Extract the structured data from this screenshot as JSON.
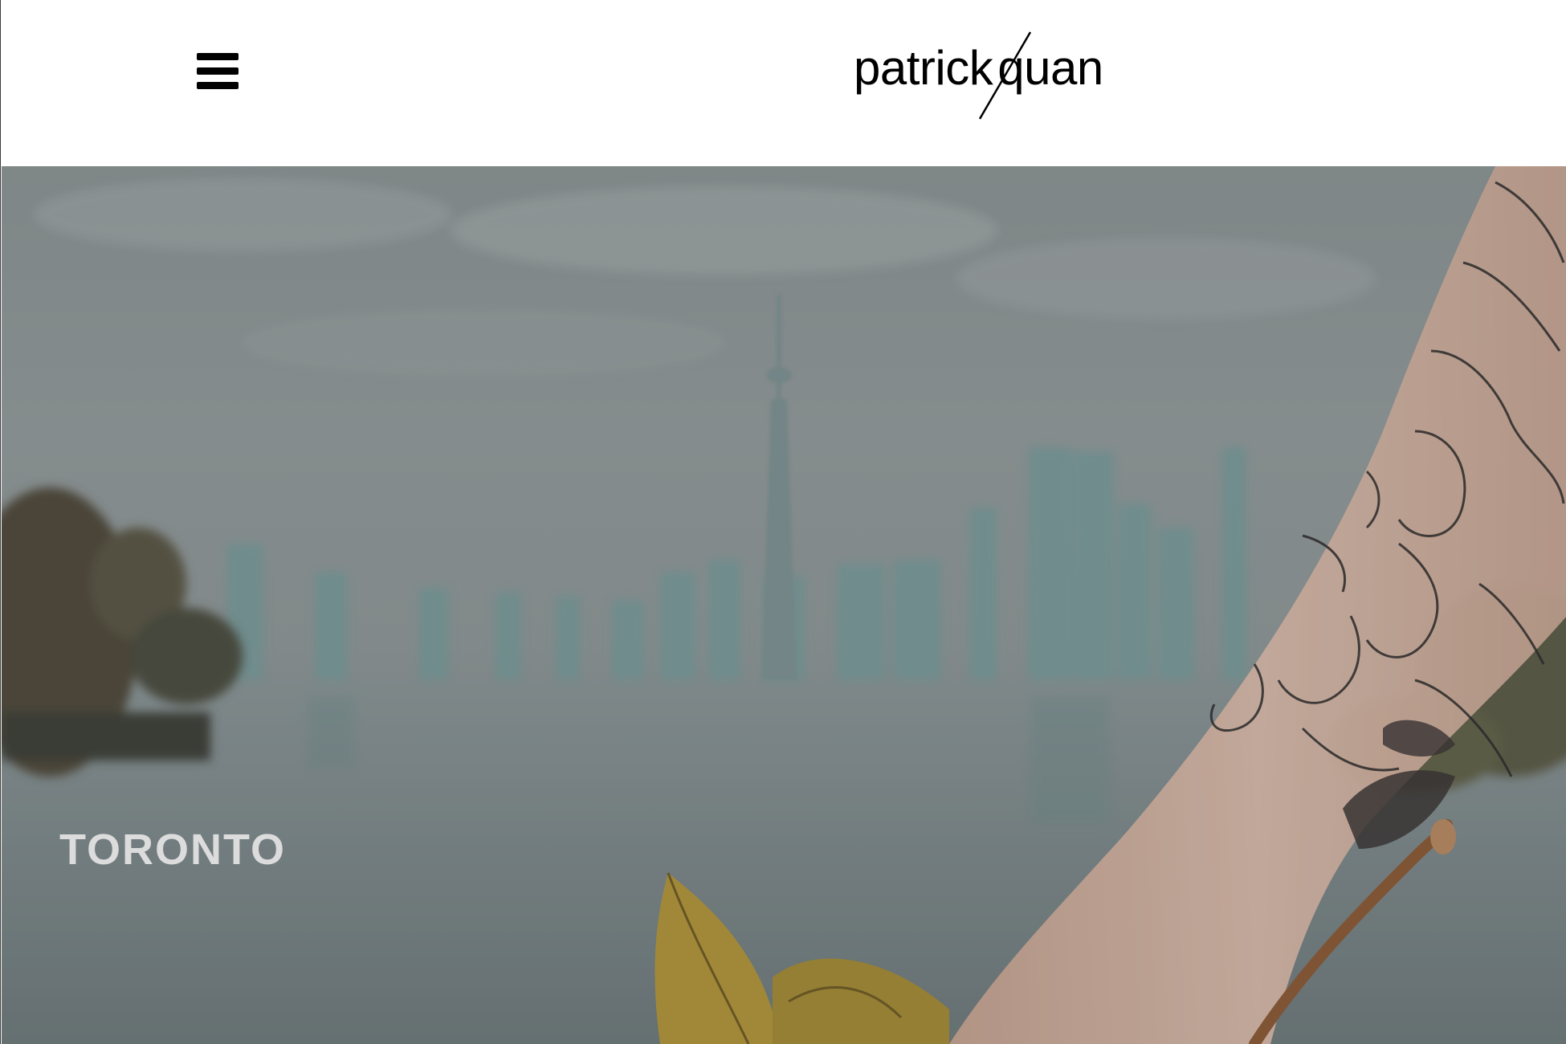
{
  "header": {
    "menu_icon": "hamburger-icon",
    "logo": {
      "part1": "patrick",
      "part2": "quan"
    }
  },
  "hero": {
    "title": "TORONTO",
    "colors": {
      "sky": "#929a9b",
      "water": "#7b8788",
      "skyline": "#6f9a9a",
      "skin": "#d8b8a6",
      "leaf": "#b59b3a"
    }
  }
}
